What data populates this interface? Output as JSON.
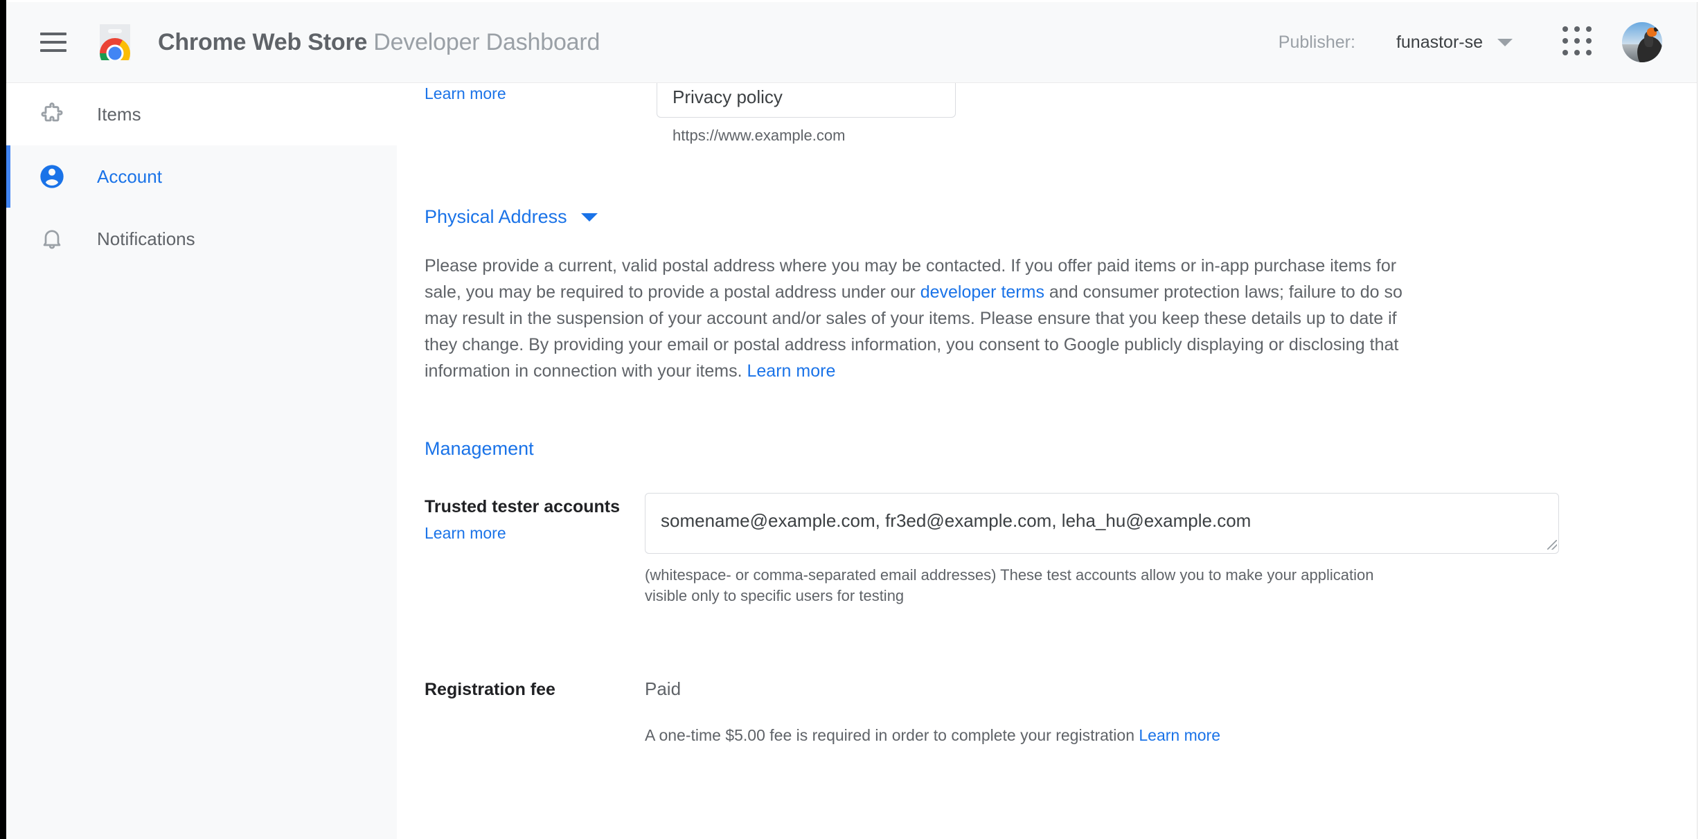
{
  "header": {
    "menu_icon": "hamburger-menu-icon",
    "logo_icon": "chrome-web-store-logo",
    "title_strong": "Chrome Web Store",
    "title_light": "Developer Dashboard",
    "publisher_label": "Publisher:",
    "publisher_value": "funastor-se",
    "publisher_caret_icon": "chevron-down-icon",
    "apps_icon": "apps-grid-icon",
    "avatar_icon": "user-avatar"
  },
  "sidebar": {
    "items": [
      {
        "label": "Items",
        "icon": "puzzle-piece-icon",
        "selected": false
      },
      {
        "label": "Account",
        "icon": "account-circle-icon",
        "selected": true
      },
      {
        "label": "Notifications",
        "icon": "bell-icon",
        "selected": false
      }
    ]
  },
  "main": {
    "cutoff_row": {
      "learn_more": "Learn more",
      "field_value": "Privacy policy",
      "helper": "https://www.example.com"
    },
    "physical_address": {
      "heading": "Physical Address",
      "caret_icon": "chevron-down-icon",
      "paragraph_part1": "Please provide a current, valid postal address where you may be contacted. If you offer paid items or in-app purchase items for sale, you may be required to provide a postal address under our ",
      "paragraph_link1": "developer terms",
      "paragraph_part2": " and consumer protection laws; failure to do so may result in the suspension of your account and/or sales of your items. Please ensure that you keep these details up to date if they change. By providing your email or postal address information, you consent to Google publicly displaying or disclosing that information in connection with your items. ",
      "paragraph_link2": "Learn more"
    },
    "management": {
      "heading": "Management",
      "trusted_testers": {
        "label": "Trusted tester accounts",
        "learn_more": "Learn more",
        "value": "somename@example.com, fr3ed@example.com, leha_hu@example.com",
        "placeholder": "whitespace- or comma-separated email addresses",
        "helper": "(whitespace- or comma-separated email addresses) These test accounts allow you to make your application visible only to specific users for testing"
      },
      "registration_fee": {
        "label": "Registration fee",
        "value": "Paid",
        "note_text": "A one-time $5.00 fee is required in order to complete your registration ",
        "note_link": "Learn more"
      }
    }
  },
  "colors": {
    "accent_blue": "#1a73e8",
    "sidebar_bg": "#f8f9fa",
    "text_primary": "#202124",
    "text_secondary": "#5f6368"
  }
}
